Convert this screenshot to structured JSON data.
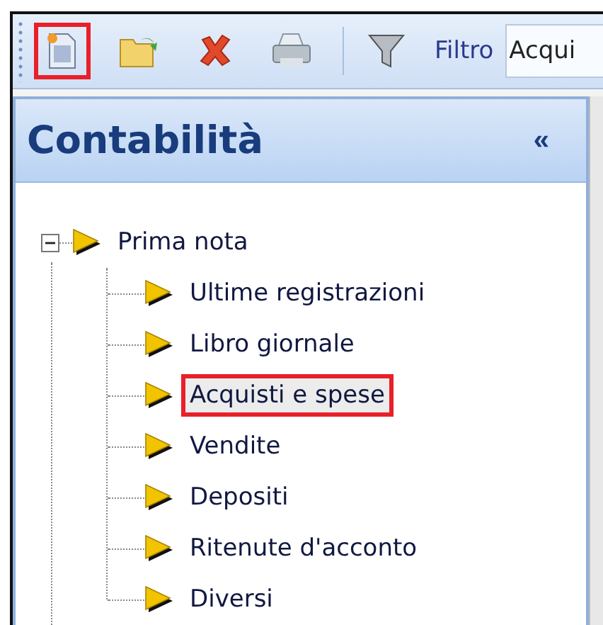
{
  "toolbar": {
    "buttons": [
      {
        "kind": "new",
        "highlighted": true
      },
      {
        "kind": "open",
        "highlighted": false
      },
      {
        "kind": "delete",
        "highlighted": false
      },
      {
        "kind": "print",
        "highlighted": false
      },
      {
        "kind": "filter",
        "highlighted": false
      }
    ],
    "filter_label": "Filtro",
    "filter_value": "Acqui"
  },
  "panel": {
    "title": "Contabilità",
    "collapse": "«",
    "tree": [
      {
        "label": "Prima nota",
        "expanded": true,
        "selected": false,
        "highlighted": false,
        "children": [
          {
            "label": "Ultime registrazioni",
            "selected": false,
            "highlighted": false
          },
          {
            "label": "Libro giornale",
            "selected": false,
            "highlighted": false
          },
          {
            "label": "Acquisti e spese",
            "selected": true,
            "highlighted": true
          },
          {
            "label": "Vendite",
            "selected": false,
            "highlighted": false
          },
          {
            "label": "Depositi",
            "selected": false,
            "highlighted": false
          },
          {
            "label": "Ritenute d'acconto",
            "selected": false,
            "highlighted": false
          },
          {
            "label": "Diversi",
            "selected": false,
            "highlighted": false
          }
        ]
      }
    ]
  }
}
